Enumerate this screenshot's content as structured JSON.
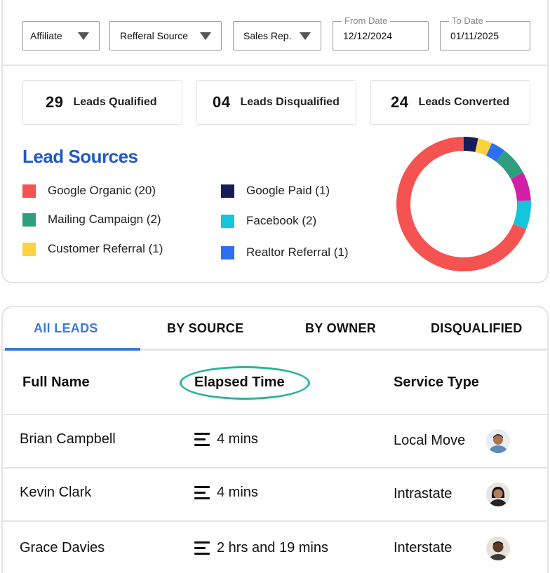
{
  "filters": {
    "affiliate": "Affiliate",
    "referral_source": "Refferal Source",
    "sales_rep": "Sales Rep.",
    "from_date_label": "From Date",
    "from_date": "12/12/2024",
    "to_date_label": "To Date",
    "to_date": "01/11/2025"
  },
  "stats": [
    {
      "num": "29",
      "label": "Leads Qualified"
    },
    {
      "num": "04",
      "label": "Leads Disqualified"
    },
    {
      "num": "24",
      "label": "Leads Converted"
    }
  ],
  "lead_sources": {
    "title": "Lead Sources",
    "items": [
      {
        "label": "Google Organic (20)",
        "color": "#f55252"
      },
      {
        "label": "Mailing Campaign (2)",
        "color": "#2f9e7e"
      },
      {
        "label": "Customer Referral (1)",
        "color": "#ffd23f"
      },
      {
        "label": "Google Paid (1)",
        "color": "#141c5a"
      },
      {
        "label": "Facebook (2)",
        "color": "#14c6dc"
      },
      {
        "label": "Realtor Referral (1)",
        "color": "#2e6ff2"
      }
    ]
  },
  "chart_data": {
    "type": "pie",
    "title": "Lead Sources",
    "donut": true,
    "series": [
      {
        "name": "Google Organic",
        "value": 20,
        "color": "#f55252"
      },
      {
        "name": "Google Paid",
        "value": 1,
        "color": "#141c5a"
      },
      {
        "name": "Customer Referral",
        "value": 1,
        "color": "#ffd23f"
      },
      {
        "name": "Realtor Referral",
        "value": 1,
        "color": "#2e6ff2"
      },
      {
        "name": "Mailing Campaign",
        "value": 2,
        "color": "#2f9e7e"
      },
      {
        "name": "",
        "value": 2,
        "color": "#d11fa7"
      },
      {
        "name": "Facebook",
        "value": 2,
        "color": "#14c6dc"
      }
    ]
  },
  "tabs": [
    "All  LEADS",
    "BY SOURCE",
    "BY OWNER",
    "DISQUALIFIED"
  ],
  "table": {
    "headers": [
      "Full Name",
      "Elapsed Time",
      "Service Type"
    ],
    "rows": [
      {
        "name": "Brian Campbell",
        "elapsed": "4 mins",
        "service": "Local Move"
      },
      {
        "name": "Kevin Clark",
        "elapsed": "4 mins",
        "service": "Intrastate"
      },
      {
        "name": "Grace Davies",
        "elapsed": "2 hrs and 19 mins",
        "service": "Interstate"
      }
    ]
  }
}
